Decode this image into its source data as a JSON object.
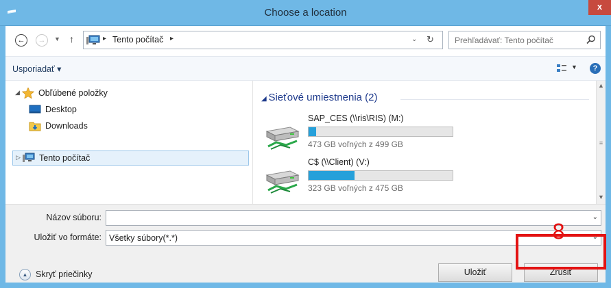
{
  "window": {
    "title": "Choose a location",
    "close_glyph": "x",
    "app_icon": "explorer-icon"
  },
  "address_bar": {
    "back_glyph": "←",
    "forward_glyph": "→",
    "up_glyph": "↑",
    "breadcrumb": "Tento počítač",
    "crumb_sep": "▸"
  },
  "search": {
    "placeholder": "Prehľadávať: Tento počítač"
  },
  "toolbar": {
    "organize_label": "Usporiadať ▾",
    "help_glyph": "?"
  },
  "nav_pane": {
    "favorites_label": "Obľúbené položky",
    "desktop_label": "Desktop",
    "downloads_label": "Downloads",
    "this_pc_label": "Tento počítač"
  },
  "content": {
    "group_header": "Sieťové umiestnenia (2)",
    "drives": [
      {
        "name": "SAP_CES (\\\\ris\\RIS) (M:)",
        "free_text": "473 GB voľných z 499 GB",
        "used_fraction": 0.05
      },
      {
        "name": "C$ (\\\\Client) (V:)",
        "free_text": "323 GB voľných z 475 GB",
        "used_fraction": 0.32
      }
    ]
  },
  "form": {
    "filename_label": "Názov súboru:",
    "filename_value": "",
    "filetype_label": "Uložiť vo formáte:",
    "filetype_value": "Všetky súbory(*.*)"
  },
  "footer": {
    "hide_folders_label": "Skryť priečinky",
    "save_label": "Uložiť",
    "cancel_label": "Zrušiť"
  },
  "annotation": {
    "number": "8",
    "color": "#e31313"
  },
  "colors": {
    "titlebar": "#6fb8e6",
    "close_button": "#c74a3e",
    "drive_bar_fill": "#26a0da",
    "group_header": "#1e3a8c",
    "selection": "#e5f1fb"
  }
}
